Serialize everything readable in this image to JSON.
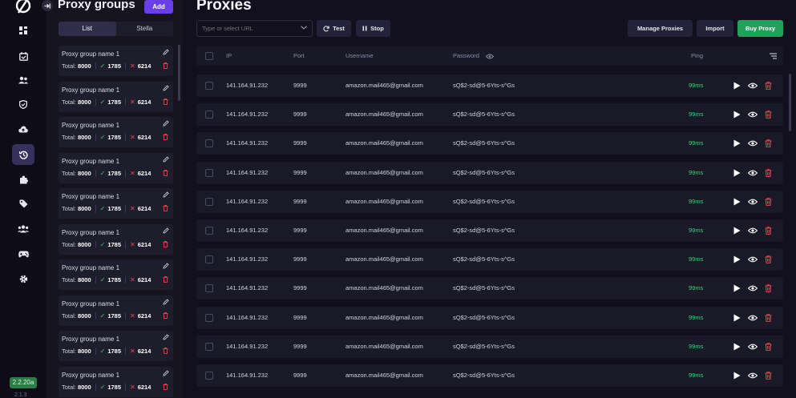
{
  "app": {
    "version": "2.2.20a",
    "version_secondary": "2.1.3"
  },
  "nav": {
    "items": [
      {
        "icon": "dashboard-icon"
      },
      {
        "icon": "calendar-check-icon"
      },
      {
        "icon": "users-icon"
      },
      {
        "icon": "shield-icon"
      },
      {
        "icon": "cloud-upload-icon"
      },
      {
        "icon": "history-icon",
        "active": true
      },
      {
        "icon": "puzzle-icon"
      },
      {
        "icon": "tag-icon"
      },
      {
        "icon": "group-icon"
      },
      {
        "icon": "gamepad-icon"
      },
      {
        "icon": "gear-icon"
      }
    ]
  },
  "groups_panel": {
    "title": "Proxy groups",
    "add_label": "Add",
    "tabs": [
      {
        "label": "List",
        "active": true
      },
      {
        "label": "Stella",
        "active": false
      }
    ],
    "total_label": "Total:",
    "groups": [
      {
        "name": "Proxy group name 1",
        "total": "8000",
        "ok": "1785",
        "failed": "6214"
      },
      {
        "name": "Proxy group name 1",
        "total": "8000",
        "ok": "1785",
        "failed": "6214"
      },
      {
        "name": "Proxy group name 1",
        "total": "8000",
        "ok": "1785",
        "failed": "6214"
      },
      {
        "name": "Proxy group name 1",
        "total": "8000",
        "ok": "1785",
        "failed": "6214"
      },
      {
        "name": "Proxy group name 1",
        "total": "8000",
        "ok": "1785",
        "failed": "6214"
      },
      {
        "name": "Proxy group name 1",
        "total": "8000",
        "ok": "1785",
        "failed": "6214"
      },
      {
        "name": "Proxy group name 1",
        "total": "8000",
        "ok": "1785",
        "failed": "6214"
      },
      {
        "name": "Proxy group name 1",
        "total": "8000",
        "ok": "1785",
        "failed": "6214"
      },
      {
        "name": "Proxy group name 1",
        "total": "8000",
        "ok": "1785",
        "failed": "6214"
      },
      {
        "name": "Proxy group name 1",
        "total": "8000",
        "ok": "1785",
        "failed": "6214"
      }
    ]
  },
  "proxies": {
    "title": "Proxies",
    "url_placeholder": "Type or select URL",
    "test_label": "Test",
    "stop_label": "Stop",
    "manage_label": "Manage Proxies",
    "import_label": "Import",
    "buy_label": "Buy Proxy",
    "columns": {
      "ip": "IP",
      "port": "Port",
      "username": "Username",
      "password": "Password",
      "ping": "Ping"
    },
    "rows": [
      {
        "ip": "141.164.91.232",
        "port": "9999",
        "username": "amazon.mail465@gmail.com",
        "password": "sQ$2-sd@5-6Yts-s^Gs",
        "ping": "99ms"
      },
      {
        "ip": "141.164.91.232",
        "port": "9999",
        "username": "amazon.mail465@gmail.com",
        "password": "sQ$2-sd@5-6Yts-s^Gs",
        "ping": "99ms"
      },
      {
        "ip": "141.164.91.232",
        "port": "9999",
        "username": "amazon.mail465@gmail.com",
        "password": "sQ$2-sd@5-6Yts-s^Gs",
        "ping": "99ms"
      },
      {
        "ip": "141.164.91.232",
        "port": "9999",
        "username": "amazon.mail465@gmail.com",
        "password": "sQ$2-sd@5-6Yts-s^Gs",
        "ping": "99ms"
      },
      {
        "ip": "141.164.91.232",
        "port": "9999",
        "username": "amazon.mail465@gmail.com",
        "password": "sQ$2-sd@5-6Yts-s^Gs",
        "ping": "99ms"
      },
      {
        "ip": "141.164.91.232",
        "port": "9999",
        "username": "amazon.mail465@gmail.com",
        "password": "sQ$2-sd@5-6Yts-s^Gs",
        "ping": "99ms"
      },
      {
        "ip": "141.164.91.232",
        "port": "9999",
        "username": "amazon.mail465@gmail.com",
        "password": "sQ$2-sd@5-6Yts-s^Gs",
        "ping": "99ms"
      },
      {
        "ip": "141.164.91.232",
        "port": "9999",
        "username": "amazon.mail465@gmail.com",
        "password": "sQ$2-sd@5-6Yts-s^Gs",
        "ping": "99ms"
      },
      {
        "ip": "141.164.91.232",
        "port": "9999",
        "username": "amazon.mail465@gmail.com",
        "password": "sQ$2-sd@5-6Yts-s^Gs",
        "ping": "99ms"
      },
      {
        "ip": "141.164.91.232",
        "port": "9999",
        "username": "amazon.mail465@gmail.com",
        "password": "sQ$2-sd@5-6Yts-s^Gs",
        "ping": "99ms"
      },
      {
        "ip": "141.164.91.232",
        "port": "9999",
        "username": "amazon.mail465@gmail.com",
        "password": "sQ$2-sd@5-6Yts-s^Gs",
        "ping": "99ms"
      }
    ]
  },
  "colors": {
    "background": "#11101c",
    "accent_purple": "#6b3fe8",
    "accent_green": "#21a05a",
    "ping_green": "#3ecf75",
    "danger_red": "#e5484d"
  }
}
